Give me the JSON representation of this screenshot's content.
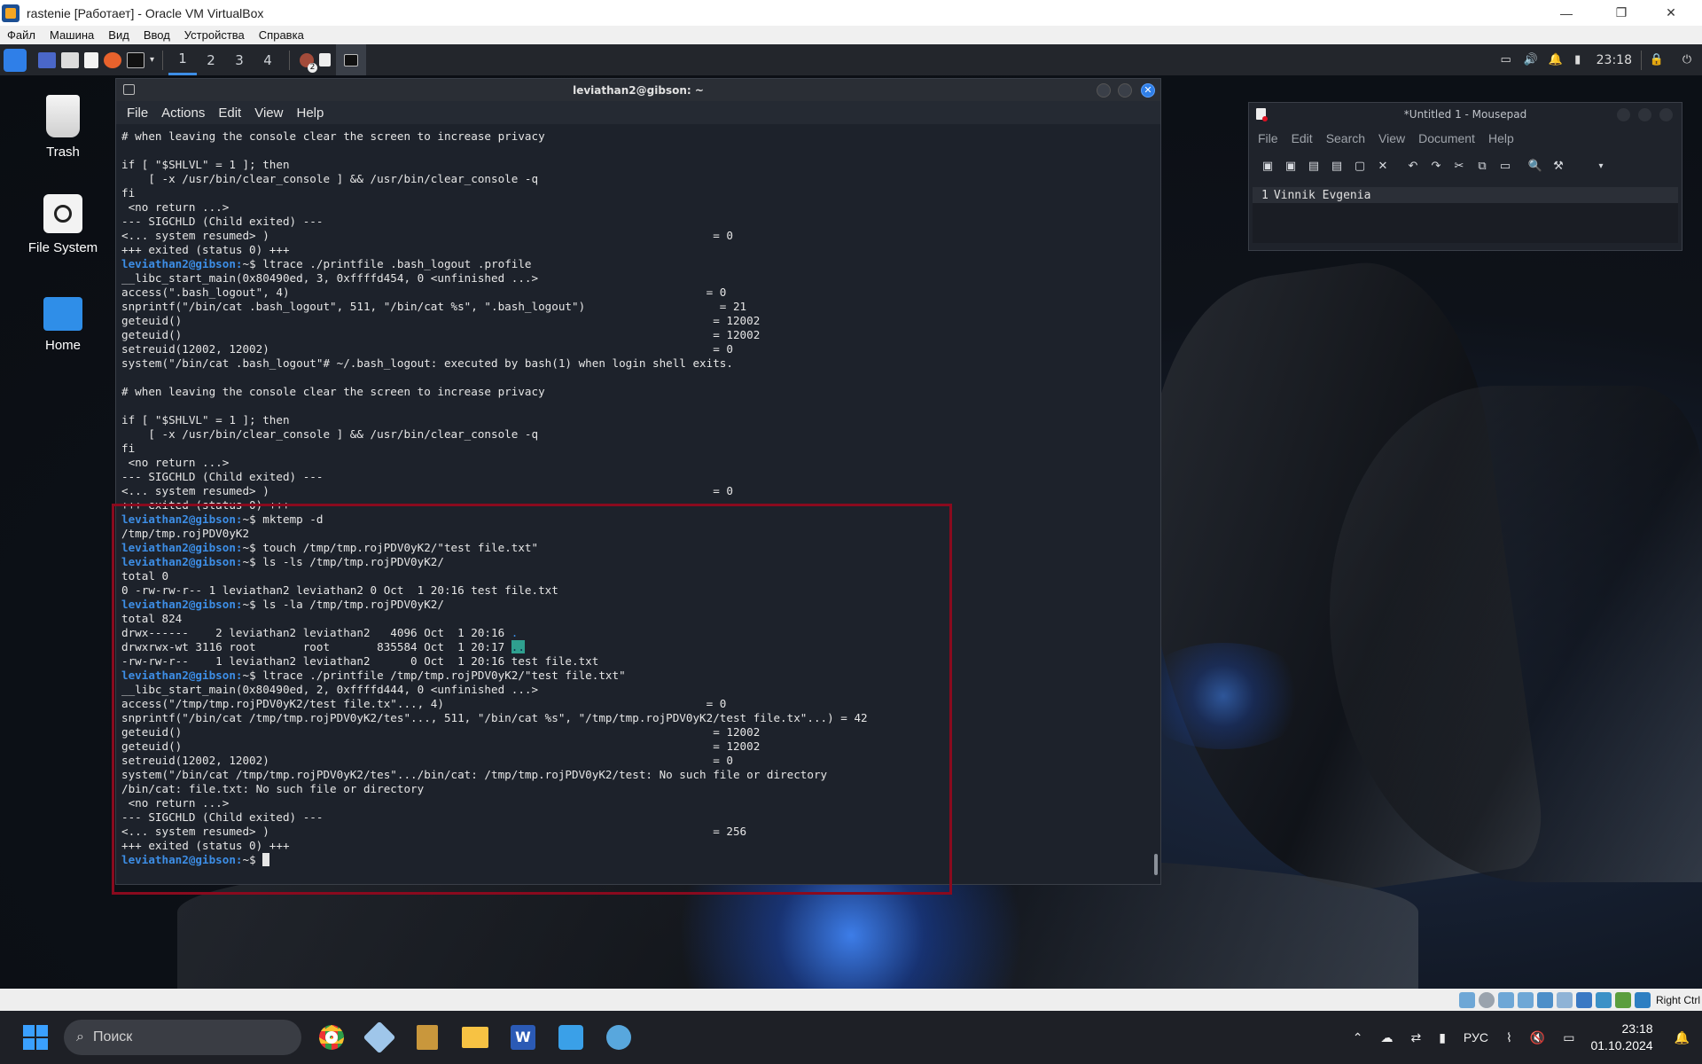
{
  "host": {
    "title": "rastenie [Работает] - Oracle VM VirtualBox",
    "menu": [
      "Файл",
      "Машина",
      "Вид",
      "Ввод",
      "Устройства",
      "Справка"
    ],
    "minimize": "—",
    "restore": "❐",
    "close": "✕"
  },
  "panel": {
    "workspaces": [
      "1",
      "2",
      "3",
      "4"
    ],
    "time": "23:18",
    "badge": "2"
  },
  "desktop_icons": [
    {
      "label": "Trash"
    },
    {
      "label": "File System"
    },
    {
      "label": "Home"
    }
  ],
  "terminal": {
    "title": "leviathan2@gibson: ~",
    "menu": [
      "File",
      "Actions",
      "Edit",
      "View",
      "Help"
    ],
    "prompt": "leviathan2@gibson:",
    "lines": [
      {
        "t": "# when leaving the console clear the screen to increase privacy"
      },
      {
        "t": ""
      },
      {
        "t": "if [ \"$SHLVL\" = 1 ]; then"
      },
      {
        "t": "    [ -x /usr/bin/clear_console ] && /usr/bin/clear_console -q"
      },
      {
        "t": "fi"
      },
      {
        "t": " <no return ...>"
      },
      {
        "t": "--- SIGCHLD (Child exited) ---"
      },
      {
        "t": "<... system resumed> )                                                                  = 0"
      },
      {
        "t": "+++ exited (status 0) +++"
      },
      {
        "p": "~$ ",
        "t": "ltrace ./printfile .bash_logout .profile"
      },
      {
        "t": "__libc_start_main(0x80490ed, 3, 0xffffd454, 0 <unfinished ...>"
      },
      {
        "t": "access(\".bash_logout\", 4)                                                              = 0"
      },
      {
        "t": "snprintf(\"/bin/cat .bash_logout\", 511, \"/bin/cat %s\", \".bash_logout\")                    = 21"
      },
      {
        "t": "geteuid()                                                                               = 12002"
      },
      {
        "t": "geteuid()                                                                               = 12002"
      },
      {
        "t": "setreuid(12002, 12002)                                                                  = 0"
      },
      {
        "t": "system(\"/bin/cat .bash_logout\"# ~/.bash_logout: executed by bash(1) when login shell exits."
      },
      {
        "t": ""
      },
      {
        "t": "# when leaving the console clear the screen to increase privacy"
      },
      {
        "t": ""
      },
      {
        "t": "if [ \"$SHLVL\" = 1 ]; then"
      },
      {
        "t": "    [ -x /usr/bin/clear_console ] && /usr/bin/clear_console -q"
      },
      {
        "t": "fi"
      },
      {
        "t": " <no return ...>"
      },
      {
        "t": "--- SIGCHLD (Child exited) ---"
      },
      {
        "t": "<... system resumed> )                                                                  = 0"
      },
      {
        "t": "+++ exited (status 0) +++"
      },
      {
        "p": "~$ ",
        "t": "mktemp -d"
      },
      {
        "t": "/tmp/tmp.rojPDV0yK2"
      },
      {
        "p": "~$ ",
        "t": "touch /tmp/tmp.rojPDV0yK2/\"test file.txt\""
      },
      {
        "p": "~$ ",
        "t": "ls -ls /tmp/tmp.rojPDV0yK2/"
      },
      {
        "t": "total 0"
      },
      {
        "t": "0 -rw-rw-r-- 1 leviathan2 leviathan2 0 Oct  1 20:16 test file.txt"
      },
      {
        "p": "~$ ",
        "t": "ls -la /tmp/tmp.rojPDV0yK2/"
      },
      {
        "t": "total 824"
      },
      {
        "t": "drwx------    2 leviathan2 leviathan2   4096 Oct  1 20:16 ",
        "d": "."
      },
      {
        "t": "drwxrwx-wt 3116 root       root       835584 Oct  1 20:17 ",
        "h": ".."
      },
      {
        "t": "-rw-rw-r--    1 leviathan2 leviathan2      0 Oct  1 20:16 test file.txt"
      },
      {
        "p": "~$ ",
        "t": "ltrace ./printfile /tmp/tmp.rojPDV0yK2/\"test file.txt\""
      },
      {
        "t": "__libc_start_main(0x80490ed, 2, 0xffffd444, 0 <unfinished ...>"
      },
      {
        "t": "access(\"/tmp/tmp.rojPDV0yK2/test file.tx\"..., 4)                                       = 0"
      },
      {
        "t": "snprintf(\"/bin/cat /tmp/tmp.rojPDV0yK2/tes\"..., 511, \"/bin/cat %s\", \"/tmp/tmp.rojPDV0yK2/test file.tx\"...) = 42"
      },
      {
        "t": "geteuid()                                                                               = 12002"
      },
      {
        "t": "geteuid()                                                                               = 12002"
      },
      {
        "t": "setreuid(12002, 12002)                                                                  = 0"
      },
      {
        "t": "system(\"/bin/cat /tmp/tmp.rojPDV0yK2/tes\".../bin/cat: /tmp/tmp.rojPDV0yK2/test: No such file or directory"
      },
      {
        "t": "/bin/cat: file.txt: No such file or directory"
      },
      {
        "t": " <no return ...>"
      },
      {
        "t": "--- SIGCHLD (Child exited) ---"
      },
      {
        "t": "<... system resumed> )                                                                  = 256"
      },
      {
        "t": "+++ exited (status 0) +++"
      },
      {
        "p": "~$ ",
        "t": "",
        "c": true
      }
    ]
  },
  "mousepad": {
    "title": "*Untitled 1 - Mousepad",
    "menu": [
      "File",
      "Edit",
      "Search",
      "View",
      "Document",
      "Help"
    ],
    "line_number": "1",
    "content": "Vinnik Evgenia"
  },
  "vbox_status": {
    "host_key": "Right Ctrl"
  },
  "taskbar": {
    "search_placeholder": "Поиск",
    "language": "РУС",
    "time": "23:18",
    "date": "01.10.2024"
  }
}
